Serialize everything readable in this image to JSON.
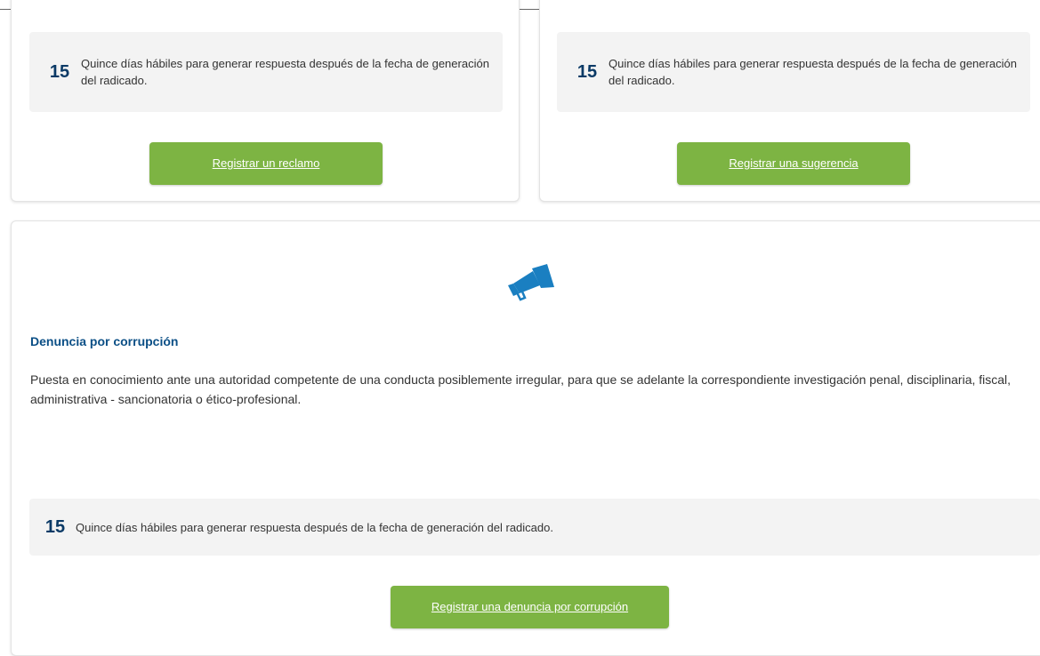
{
  "cards": {
    "reclamo": {
      "days": "15",
      "text": "Quince días hábiles para generar respuesta después de la fecha de generación del radicado.",
      "button_label": "Registrar un reclamo"
    },
    "sugerencia": {
      "days": "15",
      "text": "Quince días hábiles para generar respuesta después de la fecha de generación del radicado.",
      "button_label": "Registrar una sugerencia"
    },
    "denuncia": {
      "icon": "megaphone-icon",
      "title": "Denuncia por corrupción",
      "description": "Puesta en conocimiento ante una autoridad competente de una conducta posiblemente irregular, para que se adelante la correspondiente investigación penal, disciplinaria, fiscal, administrativa - sancionatoria o ético-profesional.",
      "days": "15",
      "text": "Quince días hábiles para generar respuesta después de la fecha de generación del radicado.",
      "button_label": "Registrar una denuncia por corrupción"
    }
  },
  "colors": {
    "button_green": "#7db443",
    "title_blue": "#0b4f86",
    "days_blue": "#0b3a66",
    "icon_blue": "#1a7fc1",
    "info_bg": "#f3f3f3"
  }
}
